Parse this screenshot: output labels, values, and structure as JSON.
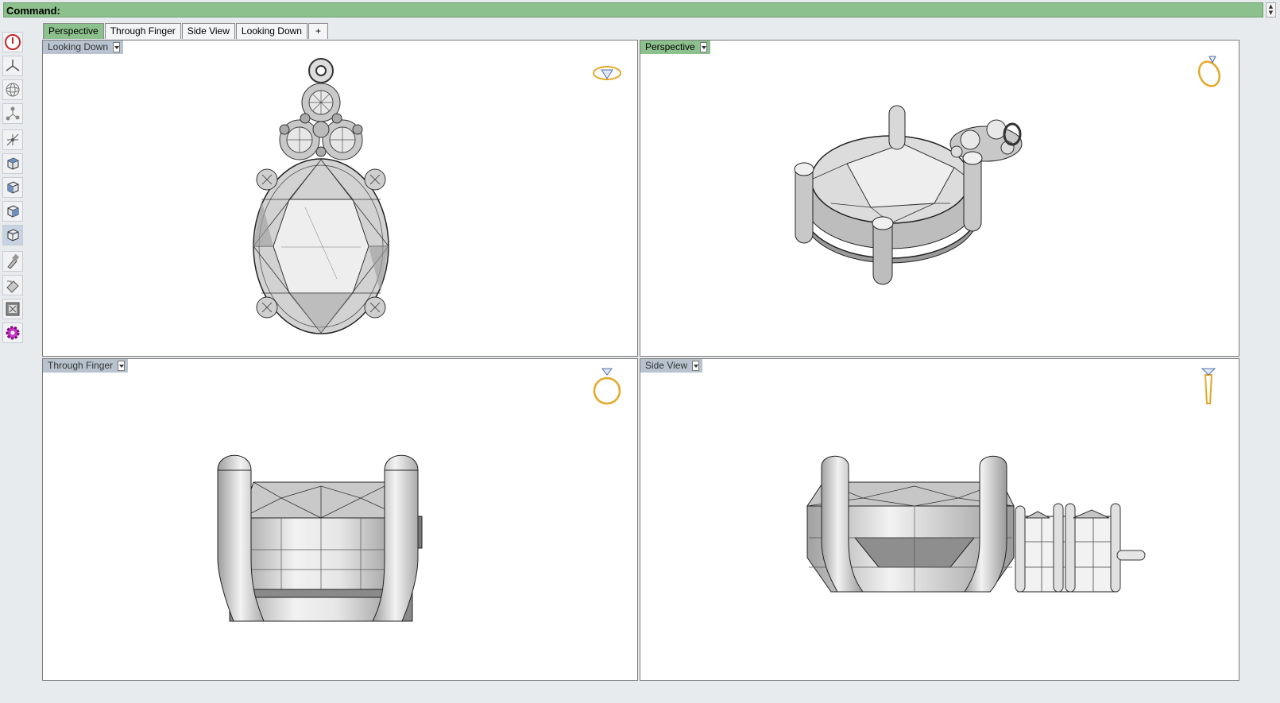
{
  "command": {
    "label": "Command:"
  },
  "tabs": [
    {
      "label": "Perspective",
      "active": true
    },
    {
      "label": "Through Finger",
      "active": false
    },
    {
      "label": "Side View",
      "active": false
    },
    {
      "label": "Looking Down",
      "active": false
    },
    {
      "label": "+",
      "active": false
    }
  ],
  "toolbar": {
    "icons": [
      "power-icon",
      "axes-icon",
      "sphere-icon",
      "molecule-icon",
      "gumball-icon",
      "cube-top-icon",
      "cube-front-icon",
      "cube-side-icon",
      "cube-persp-icon",
      "brush-icon",
      "eraser-icon",
      "render-icon",
      "settings-icon"
    ]
  },
  "viewports": {
    "top_left": {
      "label": "Looking Down"
    },
    "top_right": {
      "label": "Perspective"
    },
    "bottom_left": {
      "label": "Through Finger"
    },
    "bottom_right": {
      "label": "Side View"
    }
  },
  "colors": {
    "accent": "#8cc08c",
    "gold": "#e4a82a",
    "label_bg": "#b8c3cf"
  }
}
